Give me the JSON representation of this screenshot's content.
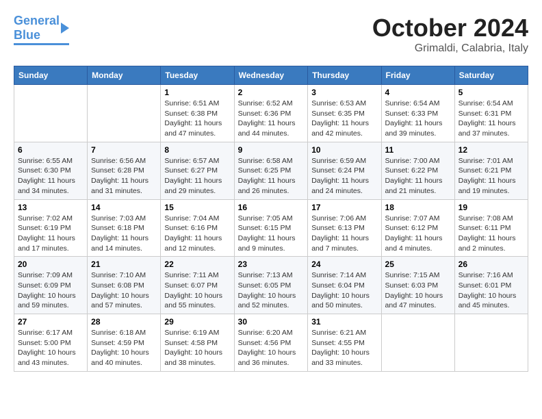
{
  "header": {
    "logo_line1_general": "General",
    "logo_line2_blue": "Blue",
    "month_title": "October 2024",
    "location": "Grimaldi, Calabria, Italy"
  },
  "calendar": {
    "weekdays": [
      "Sunday",
      "Monday",
      "Tuesday",
      "Wednesday",
      "Thursday",
      "Friday",
      "Saturday"
    ],
    "weeks": [
      [
        {
          "day": "",
          "sunrise": "",
          "sunset": "",
          "daylight": ""
        },
        {
          "day": "",
          "sunrise": "",
          "sunset": "",
          "daylight": ""
        },
        {
          "day": "1",
          "sunrise": "Sunrise: 6:51 AM",
          "sunset": "Sunset: 6:38 PM",
          "daylight": "Daylight: 11 hours and 47 minutes."
        },
        {
          "day": "2",
          "sunrise": "Sunrise: 6:52 AM",
          "sunset": "Sunset: 6:36 PM",
          "daylight": "Daylight: 11 hours and 44 minutes."
        },
        {
          "day": "3",
          "sunrise": "Sunrise: 6:53 AM",
          "sunset": "Sunset: 6:35 PM",
          "daylight": "Daylight: 11 hours and 42 minutes."
        },
        {
          "day": "4",
          "sunrise": "Sunrise: 6:54 AM",
          "sunset": "Sunset: 6:33 PM",
          "daylight": "Daylight: 11 hours and 39 minutes."
        },
        {
          "day": "5",
          "sunrise": "Sunrise: 6:54 AM",
          "sunset": "Sunset: 6:31 PM",
          "daylight": "Daylight: 11 hours and 37 minutes."
        }
      ],
      [
        {
          "day": "6",
          "sunrise": "Sunrise: 6:55 AM",
          "sunset": "Sunset: 6:30 PM",
          "daylight": "Daylight: 11 hours and 34 minutes."
        },
        {
          "day": "7",
          "sunrise": "Sunrise: 6:56 AM",
          "sunset": "Sunset: 6:28 PM",
          "daylight": "Daylight: 11 hours and 31 minutes."
        },
        {
          "day": "8",
          "sunrise": "Sunrise: 6:57 AM",
          "sunset": "Sunset: 6:27 PM",
          "daylight": "Daylight: 11 hours and 29 minutes."
        },
        {
          "day": "9",
          "sunrise": "Sunrise: 6:58 AM",
          "sunset": "Sunset: 6:25 PM",
          "daylight": "Daylight: 11 hours and 26 minutes."
        },
        {
          "day": "10",
          "sunrise": "Sunrise: 6:59 AM",
          "sunset": "Sunset: 6:24 PM",
          "daylight": "Daylight: 11 hours and 24 minutes."
        },
        {
          "day": "11",
          "sunrise": "Sunrise: 7:00 AM",
          "sunset": "Sunset: 6:22 PM",
          "daylight": "Daylight: 11 hours and 21 minutes."
        },
        {
          "day": "12",
          "sunrise": "Sunrise: 7:01 AM",
          "sunset": "Sunset: 6:21 PM",
          "daylight": "Daylight: 11 hours and 19 minutes."
        }
      ],
      [
        {
          "day": "13",
          "sunrise": "Sunrise: 7:02 AM",
          "sunset": "Sunset: 6:19 PM",
          "daylight": "Daylight: 11 hours and 17 minutes."
        },
        {
          "day": "14",
          "sunrise": "Sunrise: 7:03 AM",
          "sunset": "Sunset: 6:18 PM",
          "daylight": "Daylight: 11 hours and 14 minutes."
        },
        {
          "day": "15",
          "sunrise": "Sunrise: 7:04 AM",
          "sunset": "Sunset: 6:16 PM",
          "daylight": "Daylight: 11 hours and 12 minutes."
        },
        {
          "day": "16",
          "sunrise": "Sunrise: 7:05 AM",
          "sunset": "Sunset: 6:15 PM",
          "daylight": "Daylight: 11 hours and 9 minutes."
        },
        {
          "day": "17",
          "sunrise": "Sunrise: 7:06 AM",
          "sunset": "Sunset: 6:13 PM",
          "daylight": "Daylight: 11 hours and 7 minutes."
        },
        {
          "day": "18",
          "sunrise": "Sunrise: 7:07 AM",
          "sunset": "Sunset: 6:12 PM",
          "daylight": "Daylight: 11 hours and 4 minutes."
        },
        {
          "day": "19",
          "sunrise": "Sunrise: 7:08 AM",
          "sunset": "Sunset: 6:11 PM",
          "daylight": "Daylight: 11 hours and 2 minutes."
        }
      ],
      [
        {
          "day": "20",
          "sunrise": "Sunrise: 7:09 AM",
          "sunset": "Sunset: 6:09 PM",
          "daylight": "Daylight: 10 hours and 59 minutes."
        },
        {
          "day": "21",
          "sunrise": "Sunrise: 7:10 AM",
          "sunset": "Sunset: 6:08 PM",
          "daylight": "Daylight: 10 hours and 57 minutes."
        },
        {
          "day": "22",
          "sunrise": "Sunrise: 7:11 AM",
          "sunset": "Sunset: 6:07 PM",
          "daylight": "Daylight: 10 hours and 55 minutes."
        },
        {
          "day": "23",
          "sunrise": "Sunrise: 7:13 AM",
          "sunset": "Sunset: 6:05 PM",
          "daylight": "Daylight: 10 hours and 52 minutes."
        },
        {
          "day": "24",
          "sunrise": "Sunrise: 7:14 AM",
          "sunset": "Sunset: 6:04 PM",
          "daylight": "Daylight: 10 hours and 50 minutes."
        },
        {
          "day": "25",
          "sunrise": "Sunrise: 7:15 AM",
          "sunset": "Sunset: 6:03 PM",
          "daylight": "Daylight: 10 hours and 47 minutes."
        },
        {
          "day": "26",
          "sunrise": "Sunrise: 7:16 AM",
          "sunset": "Sunset: 6:01 PM",
          "daylight": "Daylight: 10 hours and 45 minutes."
        }
      ],
      [
        {
          "day": "27",
          "sunrise": "Sunrise: 6:17 AM",
          "sunset": "Sunset: 5:00 PM",
          "daylight": "Daylight: 10 hours and 43 minutes."
        },
        {
          "day": "28",
          "sunrise": "Sunrise: 6:18 AM",
          "sunset": "Sunset: 4:59 PM",
          "daylight": "Daylight: 10 hours and 40 minutes."
        },
        {
          "day": "29",
          "sunrise": "Sunrise: 6:19 AM",
          "sunset": "Sunset: 4:58 PM",
          "daylight": "Daylight: 10 hours and 38 minutes."
        },
        {
          "day": "30",
          "sunrise": "Sunrise: 6:20 AM",
          "sunset": "Sunset: 4:56 PM",
          "daylight": "Daylight: 10 hours and 36 minutes."
        },
        {
          "day": "31",
          "sunrise": "Sunrise: 6:21 AM",
          "sunset": "Sunset: 4:55 PM",
          "daylight": "Daylight: 10 hours and 33 minutes."
        },
        {
          "day": "",
          "sunrise": "",
          "sunset": "",
          "daylight": ""
        },
        {
          "day": "",
          "sunrise": "",
          "sunset": "",
          "daylight": ""
        }
      ]
    ]
  }
}
